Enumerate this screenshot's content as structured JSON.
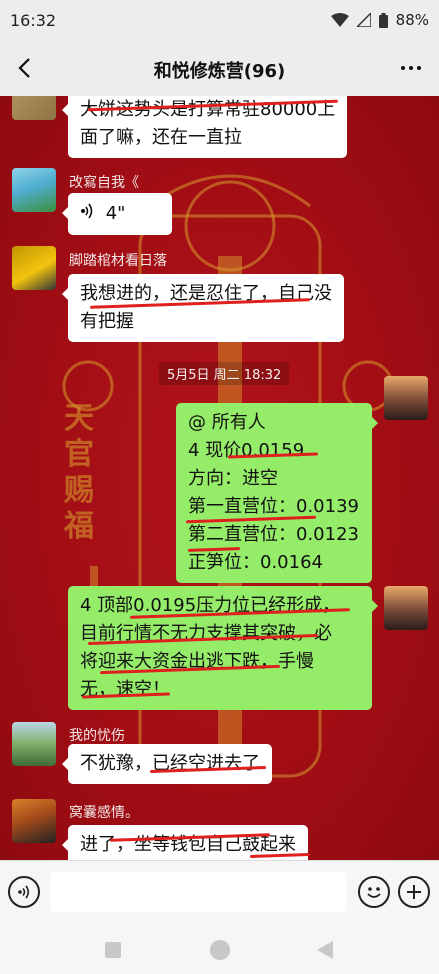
{
  "status_bar": {
    "time": "16:32",
    "battery": "88%"
  },
  "header": {
    "title": "和悦修炼营(96)"
  },
  "messages": [
    {
      "sender": "",
      "lines": [
        "大饼这势头是打算常驻80000上",
        "面了嘛，还在一直拉"
      ]
    },
    {
      "sender": "改寫自我《",
      "voice_duration": "4\""
    },
    {
      "sender": "脚踏棺材看日落",
      "lines": [
        "我想进的，还是忍住了，自己没",
        "有把握"
      ]
    },
    {
      "divider": "5月5日 周二 18:32"
    },
    {
      "sender": "self",
      "lines": [
        "@ 所有人",
        "4 现价0.0159",
        "方向：进空",
        "第一直营位：0.0139",
        "第二直营位：0.0123",
        "正笋位：0.0164"
      ]
    },
    {
      "sender": "self",
      "lines": [
        "4 顶部0.0195压力位已经形成，",
        "目前行情不无力支撑其突破，必",
        "将迎来大资金出逃下跌，手慢",
        "无，速空！"
      ]
    },
    {
      "sender": "我的忧伤",
      "lines": [
        "不犹豫，已经空进去了"
      ]
    },
    {
      "sender": "窝囊感情。",
      "lines": [
        "进了，坐等钱包自己鼓起来"
      ]
    }
  ],
  "background_art": {
    "left_text": "天官赐福"
  },
  "colors": {
    "own_bubble": "#95ec69",
    "chat_bg": "#a10d14",
    "strike": "#e0201f"
  }
}
